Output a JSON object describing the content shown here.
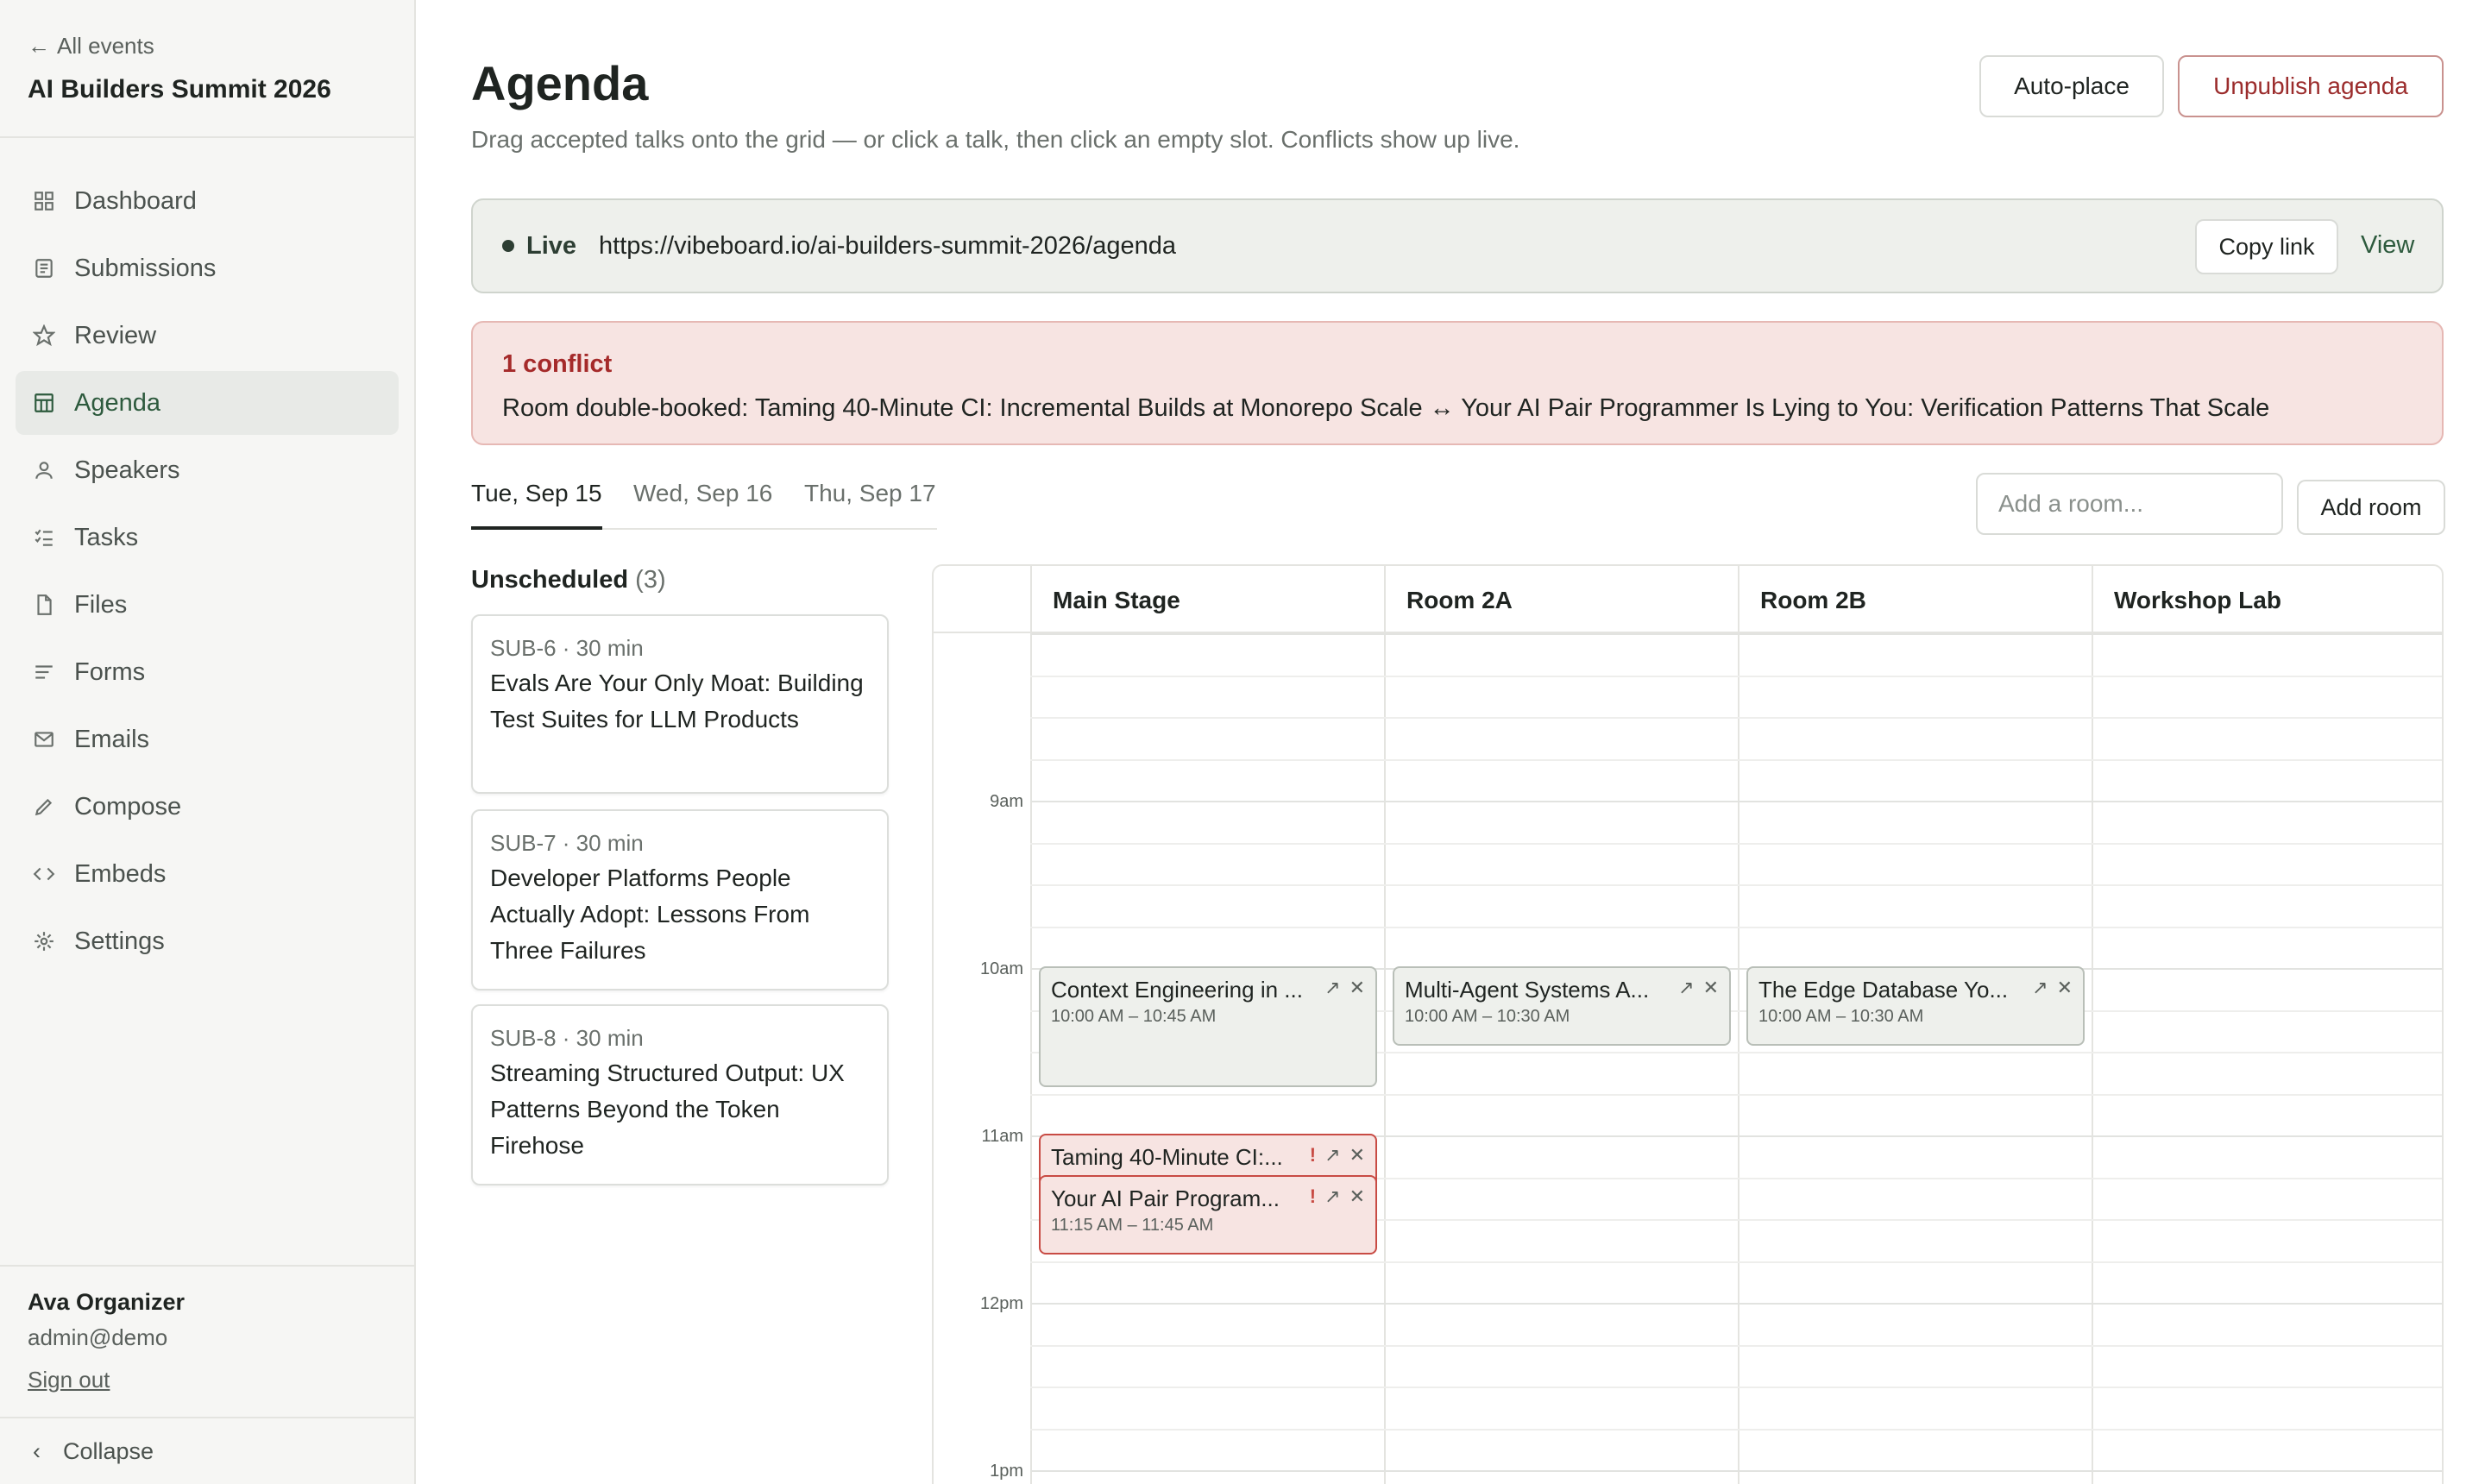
{
  "sidebar": {
    "back_link": "All events",
    "event_name": "AI Builders Summit 2026",
    "items": [
      {
        "label": "Dashboard",
        "icon": "dashboard-icon"
      },
      {
        "label": "Submissions",
        "icon": "document-icon"
      },
      {
        "label": "Review",
        "icon": "star-icon"
      },
      {
        "label": "Agenda",
        "icon": "table-icon",
        "active": true
      },
      {
        "label": "Speakers",
        "icon": "user-icon"
      },
      {
        "label": "Tasks",
        "icon": "checklist-icon"
      },
      {
        "label": "Files",
        "icon": "file-icon"
      },
      {
        "label": "Forms",
        "icon": "form-icon"
      },
      {
        "label": "Emails",
        "icon": "mail-icon"
      },
      {
        "label": "Compose",
        "icon": "pencil-icon"
      },
      {
        "label": "Embeds",
        "icon": "code-icon"
      },
      {
        "label": "Settings",
        "icon": "gear-icon"
      }
    ],
    "user": {
      "name": "Ava Organizer",
      "email": "admin@demo",
      "sign_out": "Sign out"
    },
    "collapse": "Collapse"
  },
  "header": {
    "title": "Agenda",
    "subtitle": "Drag accepted talks onto the grid — or click a talk, then click an empty slot. Conflicts show up live.",
    "auto_place": "Auto-place",
    "unpublish": "Unpublish agenda"
  },
  "live": {
    "label": "Live",
    "url": "https://vibeboard.io/ai-builders-summit-2026/agenda",
    "copy": "Copy link",
    "view": "View"
  },
  "conflict": {
    "title": "1 conflict",
    "text": "Room double-booked: Taming 40-Minute CI: Incremental Builds at Monorepo Scale ↔ Your AI Pair Programmer Is Lying to You: Verification Patterns That Scale"
  },
  "tabs": [
    "Tue, Sep 15",
    "Wed, Sep 16",
    "Thu, Sep 17"
  ],
  "room_input": {
    "placeholder": "Add a room..."
  },
  "add_room": "Add room",
  "unscheduled": {
    "title": "Unscheduled",
    "count": "(3)",
    "talks": [
      {
        "meta": "SUB-6 · 30 min",
        "title": "Evals Are Your Only Moat: Building Test Suites for LLM Products"
      },
      {
        "meta": "SUB-7 · 30 min",
        "title": "Developer Platforms People Actually Adopt: Lessons From Three Failures"
      },
      {
        "meta": "SUB-8 · 30 min",
        "title": "Streaming Structured Output: UX Patterns Beyond the Token Firehose"
      }
    ]
  },
  "grid": {
    "rooms": [
      "Main Stage",
      "Room 2A",
      "Room 2B",
      "Workshop Lab"
    ],
    "hours": [
      "9am",
      "10am",
      "11am",
      "12pm",
      "1pm"
    ],
    "sessions": [
      {
        "title": "Context Engineering in ...",
        "time": "10:00 AM – 10:45 AM",
        "conflict": false
      },
      {
        "title": "Multi-Agent Systems A...",
        "time": "10:00 AM – 10:30 AM",
        "conflict": false
      },
      {
        "title": "The Edge Database Yo...",
        "time": "10:00 AM – 10:30 AM",
        "conflict": false
      },
      {
        "title": "Taming 40-Minute CI:...",
        "time": "",
        "conflict": true
      },
      {
        "title": "Your AI Pair Program...",
        "time": "11:15 AM – 11:45 AM",
        "conflict": true
      }
    ]
  },
  "colors": {
    "accent": "#2d5a3d",
    "danger": "#a52a2a",
    "conflict_bg": "#f7e4e2",
    "live_bg": "#eef0ec"
  }
}
